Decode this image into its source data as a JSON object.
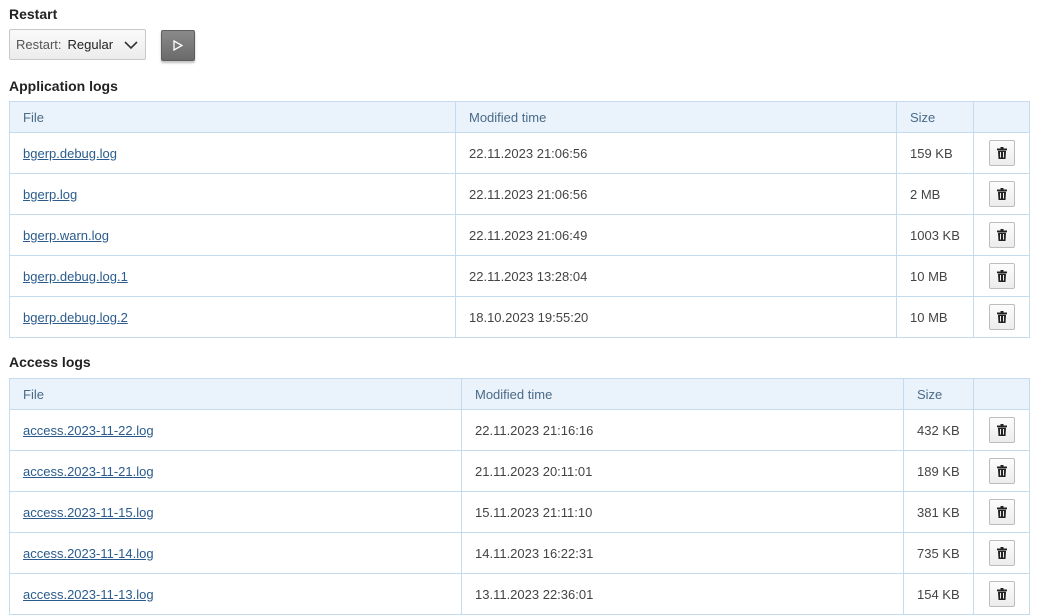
{
  "restart": {
    "title": "Restart",
    "select_prefix": "Restart:",
    "select_value": "Regular"
  },
  "app_logs": {
    "title": "Application logs",
    "columns": [
      "File",
      "Modified time",
      "Size"
    ],
    "rows": [
      {
        "file": "bgerp.debug.log",
        "modified": "22.11.2023 21:06:56",
        "size": "159 KB"
      },
      {
        "file": "bgerp.log",
        "modified": "22.11.2023 21:06:56",
        "size": "2 MB"
      },
      {
        "file": "bgerp.warn.log",
        "modified": "22.11.2023 21:06:49",
        "size": "1003 KB"
      },
      {
        "file": "bgerp.debug.log.1",
        "modified": "22.11.2023 13:28:04",
        "size": "10 MB"
      },
      {
        "file": "bgerp.debug.log.2",
        "modified": "18.10.2023 19:55:20",
        "size": "10 MB"
      }
    ]
  },
  "access_logs": {
    "title": "Access logs",
    "columns": [
      "File",
      "Modified time",
      "Size"
    ],
    "rows": [
      {
        "file": "access.2023-11-22.log",
        "modified": "22.11.2023 21:16:16",
        "size": "432 KB"
      },
      {
        "file": "access.2023-11-21.log",
        "modified": "21.11.2023 20:11:01",
        "size": "189 KB"
      },
      {
        "file": "access.2023-11-15.log",
        "modified": "15.11.2023 21:11:10",
        "size": "381 KB"
      },
      {
        "file": "access.2023-11-14.log",
        "modified": "14.11.2023 16:22:31",
        "size": "735 KB"
      },
      {
        "file": "access.2023-11-13.log",
        "modified": "13.11.2023 22:36:01",
        "size": "154 KB"
      }
    ]
  },
  "icons": {
    "run": "play-icon",
    "delete": "trash-icon",
    "select": "chevron-down-icon"
  }
}
